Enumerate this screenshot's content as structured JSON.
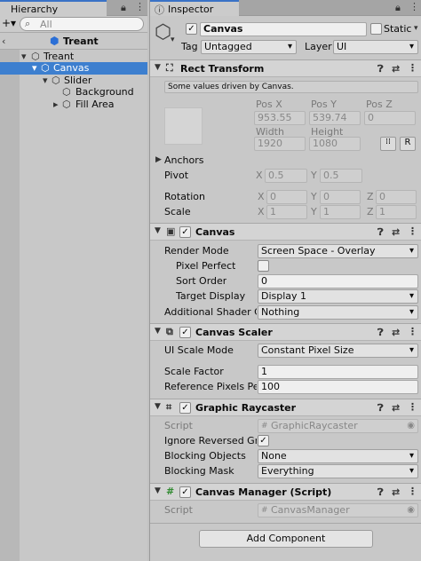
{
  "hierarchy": {
    "tab": "Hierarchy",
    "add": "+▾",
    "search_placeholder": "All",
    "scene": "Treant",
    "items": [
      {
        "label": "Treant"
      },
      {
        "label": "Canvas"
      },
      {
        "label": "Slider"
      },
      {
        "label": "Background"
      },
      {
        "label": "Fill Area"
      }
    ]
  },
  "inspector": {
    "tab": "Inspector",
    "name": "Canvas",
    "static": "Static",
    "tag_label": "Tag",
    "tag": "Untagged",
    "layer_label": "Layer",
    "layer": "UI"
  },
  "rect": {
    "title": "Rect Transform",
    "note": "Some values driven by Canvas.",
    "posx_l": "Pos X",
    "posy_l": "Pos Y",
    "posz_l": "Pos Z",
    "posx": "953.55",
    "posy": "539.74",
    "posz": "0",
    "w_l": "Width",
    "h_l": "Height",
    "w": "1920",
    "h": "1080",
    "r": "R",
    "anchors": "Anchors",
    "pivot": "Pivot",
    "px": "X",
    "pxv": "0.5",
    "py": "Y",
    "pyv": "0.5",
    "rotation": "Rotation",
    "rx": "0",
    "ry": "0",
    "rz": "0",
    "scale": "Scale",
    "sx": "1",
    "sy": "1",
    "sz": "1",
    "xl": "X",
    "yl": "Y",
    "zl": "Z"
  },
  "canvas": {
    "title": "Canvas",
    "render_mode_l": "Render Mode",
    "render_mode": "Screen Space - Overlay",
    "pixel_perfect": "Pixel Perfect",
    "sort_order_l": "Sort Order",
    "sort_order": "0",
    "target_display_l": "Target Display",
    "target_display": "Display 1",
    "shader_l": "Additional Shader Cha",
    "shader": "Nothing"
  },
  "scaler": {
    "title": "Canvas Scaler",
    "mode_l": "UI Scale Mode",
    "mode": "Constant Pixel Size",
    "factor_l": "Scale Factor",
    "factor": "1",
    "ref_l": "Reference Pixels Per U",
    "ref": "100"
  },
  "raycaster": {
    "title": "Graphic Raycaster",
    "script_l": "Script",
    "script": "GraphicRaycaster",
    "ignore_l": "Ignore Reversed Grap",
    "block_obj_l": "Blocking Objects",
    "block_obj": "None",
    "block_mask_l": "Blocking Mask",
    "block_mask": "Everything"
  },
  "manager": {
    "title": "Canvas Manager (Script)",
    "script_l": "Script",
    "script": "CanvasManager"
  },
  "add_component": "Add Component"
}
